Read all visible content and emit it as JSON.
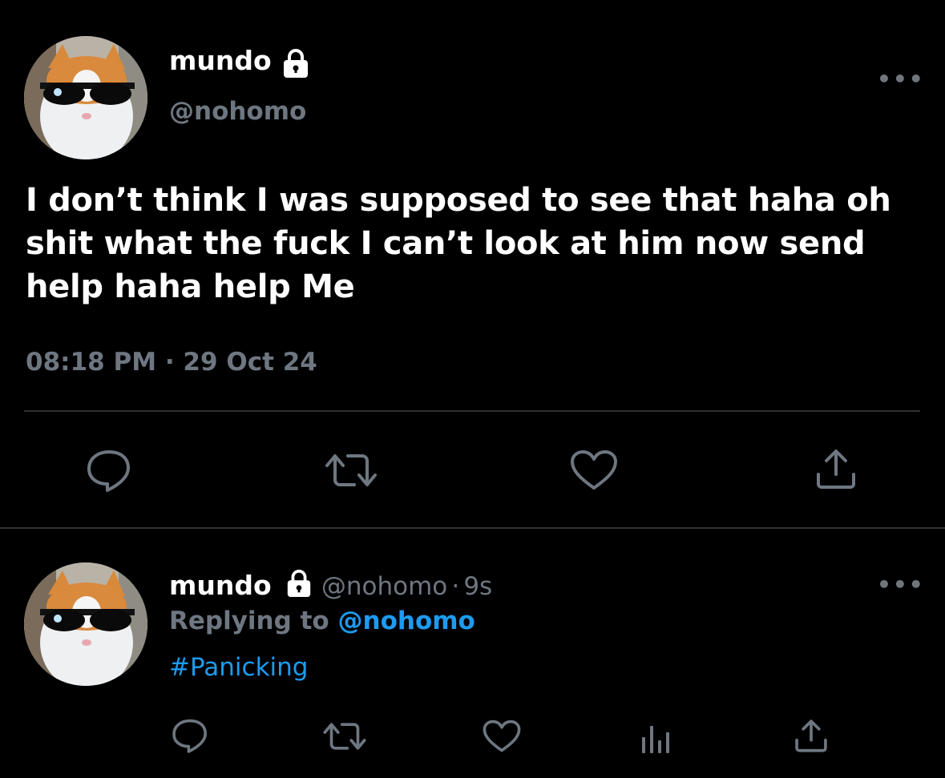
{
  "main_tweet": {
    "display_name": "mundo",
    "handle": "@nohomo",
    "text": "I don’t think I was supposed to see that haha oh shit what the fuck I can’t look at him now send help haha help Me",
    "time": "08:18 PM",
    "separator": "·",
    "date": "29 Oct 24",
    "more": "•••",
    "actions": [
      "reply-icon",
      "retweet-icon",
      "like-icon",
      "share-icon"
    ]
  },
  "reply_tweet": {
    "display_name": "mundo",
    "handle": "@nohomo",
    "dot": "·",
    "age": "9s",
    "replying_label": "Replying to",
    "replying_handle": "@nohomo",
    "text": "#Panicking",
    "more": "•••",
    "actions": [
      "reply-icon",
      "retweet-icon",
      "like-icon",
      "analytics-icon",
      "share-icon"
    ]
  },
  "colors": {
    "background": "#000000",
    "muted": "#6e7781",
    "link": "#1d9bf0",
    "divider": "#2f3336"
  }
}
